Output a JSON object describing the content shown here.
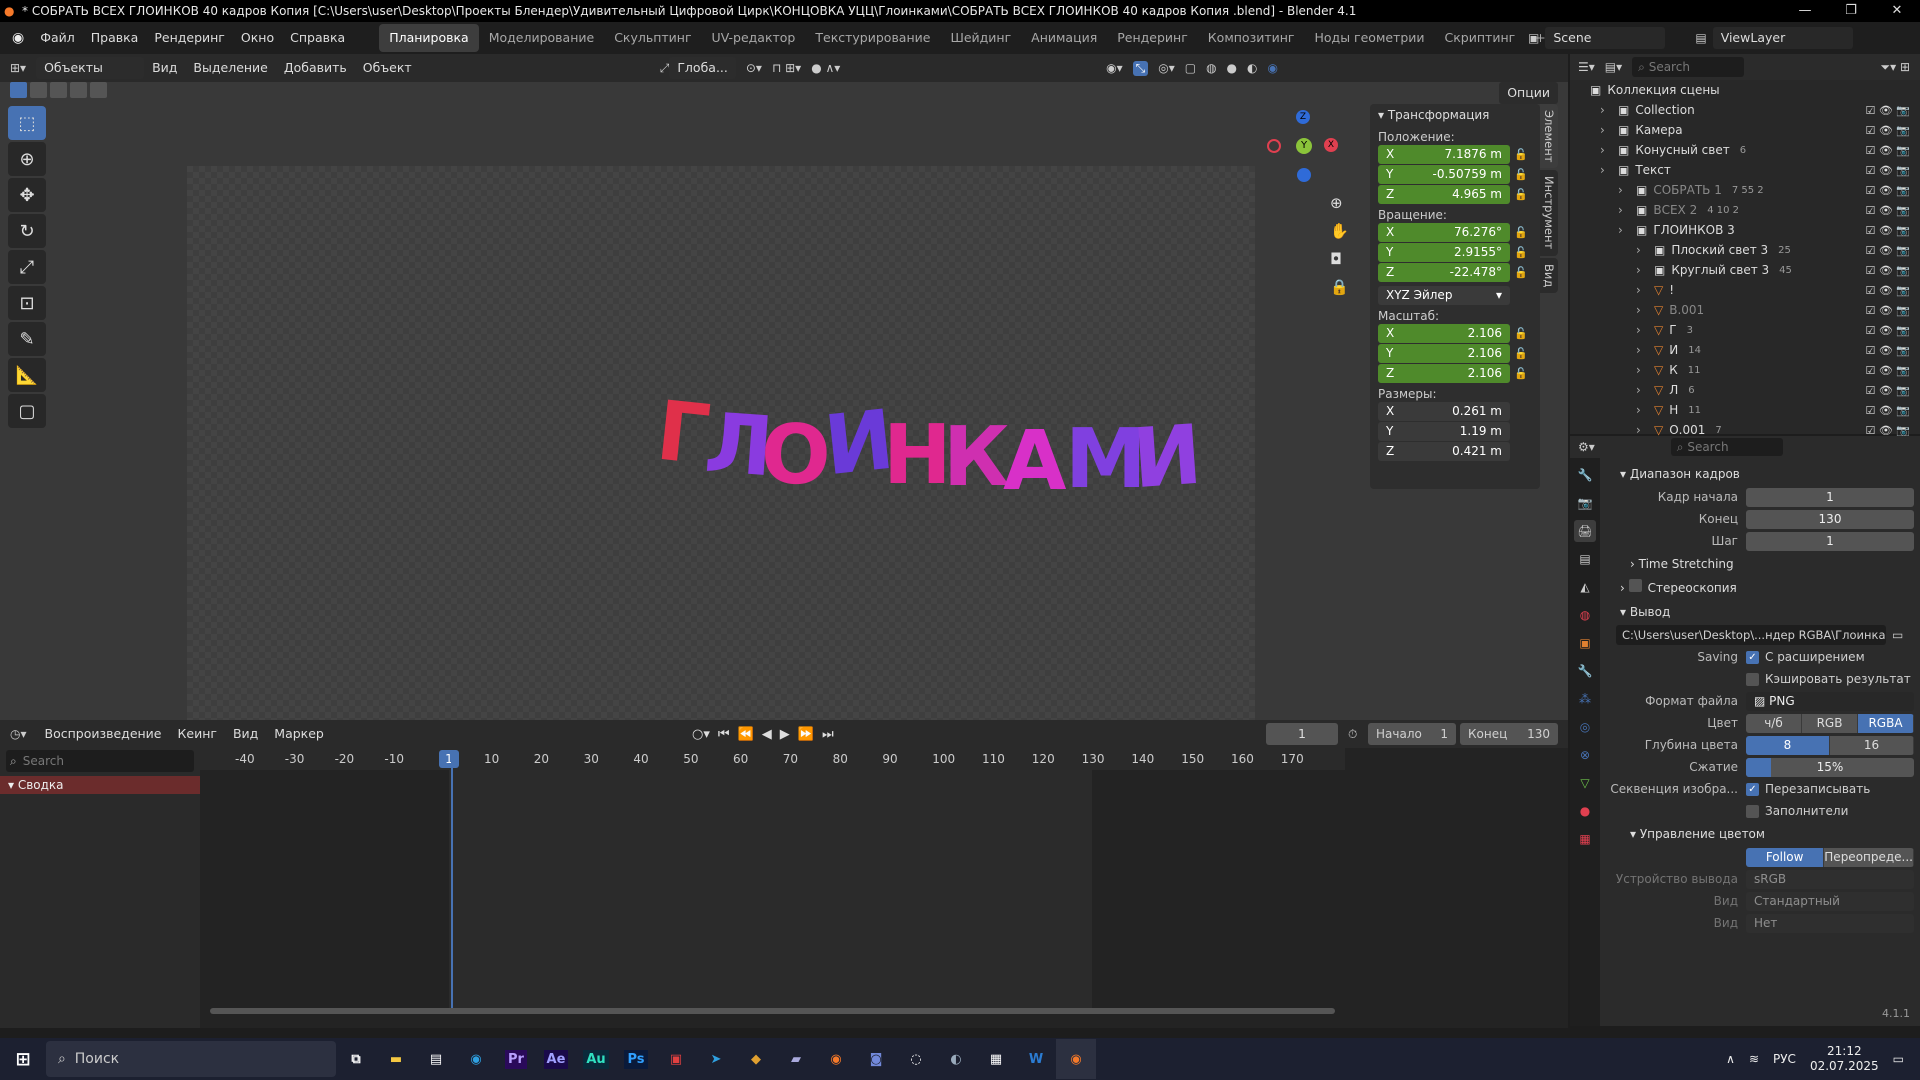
{
  "window": {
    "title": "* СОБРАТЬ ВСЕХ ГЛОИНКОВ 40 кадров Копия [C:\\Users\\user\\Desktop\\Проекты Блендер\\Удивительный Цифровой Цирк\\КОНЦОВКА УЦЦ\\Глоинками\\СОБРАТЬ ВСЕХ ГЛОИНКОВ 40 кадров Копия .blend] - Blender 4.1",
    "controls": [
      "—",
      "❐",
      "✕"
    ]
  },
  "menu": [
    "Файл",
    "Правка",
    "Рендеринг",
    "Окно",
    "Справка"
  ],
  "workspaces": [
    "Планировка",
    "Моделирование",
    "Скульптинг",
    "UV-редактор",
    "Текстурирование",
    "Шейдинг",
    "Анимация",
    "Рендеринг",
    "Композитинг",
    "Ноды геометрии",
    "Скриптинг"
  ],
  "active_workspace": "Планировка",
  "add_tab": "+",
  "scene": "Scene",
  "view_layer": "ViewLayer",
  "viewport_header": {
    "mode": "Объекты",
    "menus": [
      "Вид",
      "Выделение",
      "Добавить",
      "Объект"
    ],
    "orientation": "Глоба...",
    "options": "Опции"
  },
  "viewport_text": "ГЛОИНКАМИ",
  "gizmo": {
    "x": "X",
    "y": "Y",
    "z": "Z"
  },
  "npanel": {
    "header": "Трансформация",
    "position_label": "Положение:",
    "position": [
      {
        "axis": "X",
        "value": "7.1876 m"
      },
      {
        "axis": "Y",
        "value": "-0.50759 m"
      },
      {
        "axis": "Z",
        "value": "4.965 m"
      }
    ],
    "rotation_label": "Вращение:",
    "rotation": [
      {
        "axis": "X",
        "value": "76.276°"
      },
      {
        "axis": "Y",
        "value": "2.9155°"
      },
      {
        "axis": "Z",
        "value": "-22.478°"
      }
    ],
    "rotation_mode": "XYZ Эйлер",
    "scale_label": "Масштаб:",
    "scale": [
      {
        "axis": "X",
        "value": "2.106"
      },
      {
        "axis": "Y",
        "value": "2.106"
      },
      {
        "axis": "Z",
        "value": "2.106"
      }
    ],
    "dims_label": "Размеры:",
    "dims": [
      {
        "axis": "X",
        "value": "0.261 m"
      },
      {
        "axis": "Y",
        "value": "1.19 m"
      },
      {
        "axis": "Z",
        "value": "0.421 m"
      }
    ],
    "tabs": [
      "Элемент",
      "Инструмент",
      "Вид"
    ]
  },
  "timeline": {
    "playback": "Воспроизведение",
    "keying": "Кеинг",
    "view": "Вид",
    "marker": "Маркер",
    "current_frame": "1",
    "start_label": "Начало",
    "start": "1",
    "end_label": "Конец",
    "end": "130",
    "search_placeholder": "Search",
    "summary": "Сводка",
    "ruler": [
      "-40",
      "-30",
      "-20",
      "-10",
      "1",
      "10",
      "20",
      "30",
      "40",
      "50",
      "60",
      "70",
      "80",
      "90",
      "100",
      "110",
      "120",
      "130",
      "140",
      "150",
      "160",
      "170"
    ]
  },
  "outliner": {
    "search_placeholder": "Search",
    "root": "Коллекция сцены",
    "rows": [
      {
        "label": "Collection",
        "indent": 1,
        "extra": ""
      },
      {
        "label": "Камера",
        "indent": 1,
        "extra": ""
      },
      {
        "label": "Конусный свет",
        "indent": 1,
        "extra": "6"
      },
      {
        "label": "Текст",
        "indent": 1,
        "extra": ""
      },
      {
        "label": "СОБРАТЬ 1",
        "indent": 2,
        "extra": "7 55 2"
      },
      {
        "label": "ВСЕХ 2",
        "indent": 2,
        "extra": "4 10 2"
      },
      {
        "label": "ГЛОИНКОВ 3",
        "indent": 2,
        "extra": ""
      },
      {
        "label": "Плоский свет 3",
        "indent": 3,
        "extra": "25"
      },
      {
        "label": "Круглый свет 3",
        "indent": 3,
        "extra": "45"
      },
      {
        "label": "!",
        "indent": 3,
        "extra": ""
      },
      {
        "label": "В.001",
        "indent": 3,
        "extra": ""
      },
      {
        "label": "Г",
        "indent": 3,
        "extra": "3"
      },
      {
        "label": "И",
        "indent": 3,
        "extra": "14"
      },
      {
        "label": "К",
        "indent": 3,
        "extra": "11"
      },
      {
        "label": "Л",
        "indent": 3,
        "extra": "6"
      },
      {
        "label": "Н",
        "indent": 3,
        "extra": "11"
      },
      {
        "label": "О.001",
        "indent": 3,
        "extra": "7"
      }
    ]
  },
  "properties": {
    "search_placeholder": "Search",
    "frame_range": "Диапазон кадров",
    "frame_start_label": "Кадр начала",
    "frame_start": "1",
    "end_label": "Конец",
    "end": "130",
    "step_label": "Шаг",
    "step": "1",
    "time_stretching": "Time Stretching",
    "stereo": "Стереоскопия",
    "output": "Вывод",
    "output_path": "C:\\Users\\user\\Desktop\\...ндер RGBA\\Глоинками",
    "saving_label": "Saving",
    "with_extension": "С расширением",
    "cache_result": "Кэшировать результат",
    "file_format_label": "Формат файла",
    "file_format": "PNG",
    "color_label": "Цвет",
    "color_opts": [
      "ч/б",
      "RGB",
      "RGBA"
    ],
    "color_depth_label": "Глубина цвета",
    "color_depth": [
      "8",
      "16"
    ],
    "compression_label": "Сжатие",
    "compression": "15%",
    "compression_pct": 15,
    "image_seq_label": "Секвенция изобра...",
    "overwrite": "Перезаписывать",
    "placeholders": "Заполнители",
    "color_management": "Управление цветом",
    "follow_scene": "Follow Scene",
    "override": "Переопреде...",
    "display_device_label": "Устройство вывода",
    "display_device": "sRGB",
    "view_label": "Вид",
    "view_value": "Стандартный",
    "look_label": "Вид",
    "look_value": "Нет"
  },
  "version": "4.1.1",
  "taskbar": {
    "search": "Поиск",
    "lang": "РУС",
    "time": "21:12",
    "date": "02.07.2025",
    "apps": [
      "Pr",
      "Ae",
      "Au",
      "Ps"
    ]
  },
  "colors": {
    "accent": "#4772b3",
    "field_green": "#4f8a2b",
    "letter_pink": "#e0288f",
    "letter_purple": "#8a3be0",
    "letter_red": "#e0304a"
  }
}
